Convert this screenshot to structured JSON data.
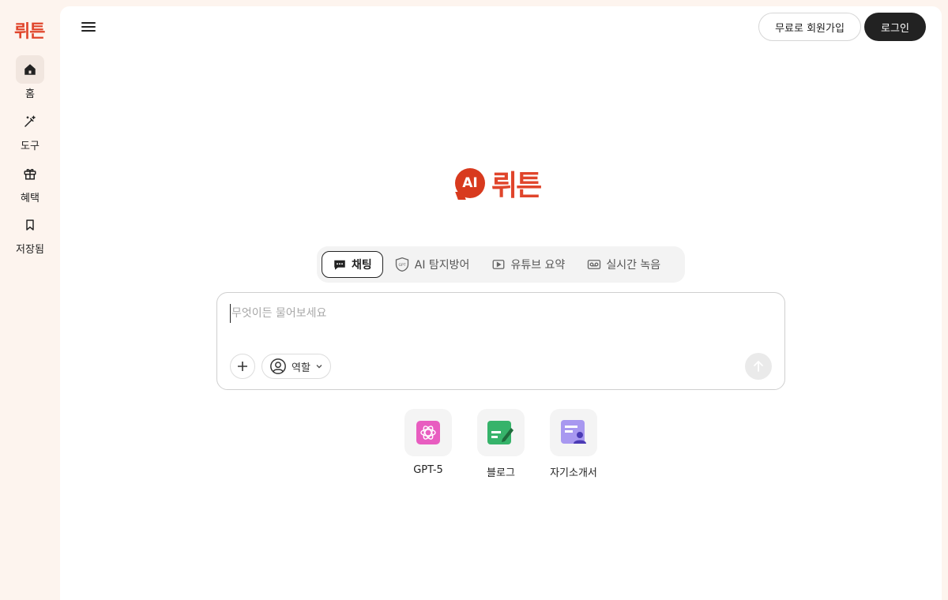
{
  "sidebar": {
    "brand": "뤼튼",
    "items": [
      {
        "label": "홈",
        "icon": "home-icon",
        "active": true
      },
      {
        "label": "도구",
        "icon": "magic-wand-icon"
      },
      {
        "label": "혜택",
        "icon": "gift-icon"
      },
      {
        "label": "저장됨",
        "icon": "bookmark-icon"
      }
    ]
  },
  "header": {
    "signup_label": "무료로 회원가입",
    "login_label": "로그인"
  },
  "logo": {
    "badge": "AI",
    "text": "뤼튼"
  },
  "tabs": [
    {
      "label": "채팅",
      "icon": "chat-bubble-icon",
      "active": true
    },
    {
      "label": "AI 탐지방어",
      "icon": "gpt-shield-icon"
    },
    {
      "label": "유튜브 요약",
      "icon": "play-icon"
    },
    {
      "label": "실시간 녹음",
      "icon": "voicemail-icon"
    }
  ],
  "chat": {
    "placeholder": "무엇이든 물어보세요",
    "role_label": "역할"
  },
  "shortcuts": [
    {
      "label": "GPT-5",
      "icon": "openai-icon"
    },
    {
      "label": "블로그",
      "icon": "blog-edit-icon"
    },
    {
      "label": "자기소개서",
      "icon": "resume-icon"
    }
  ],
  "colors": {
    "brand": "#e0452b",
    "sidebar_bg": "#fdf4ee",
    "dark_button": "#222222"
  }
}
